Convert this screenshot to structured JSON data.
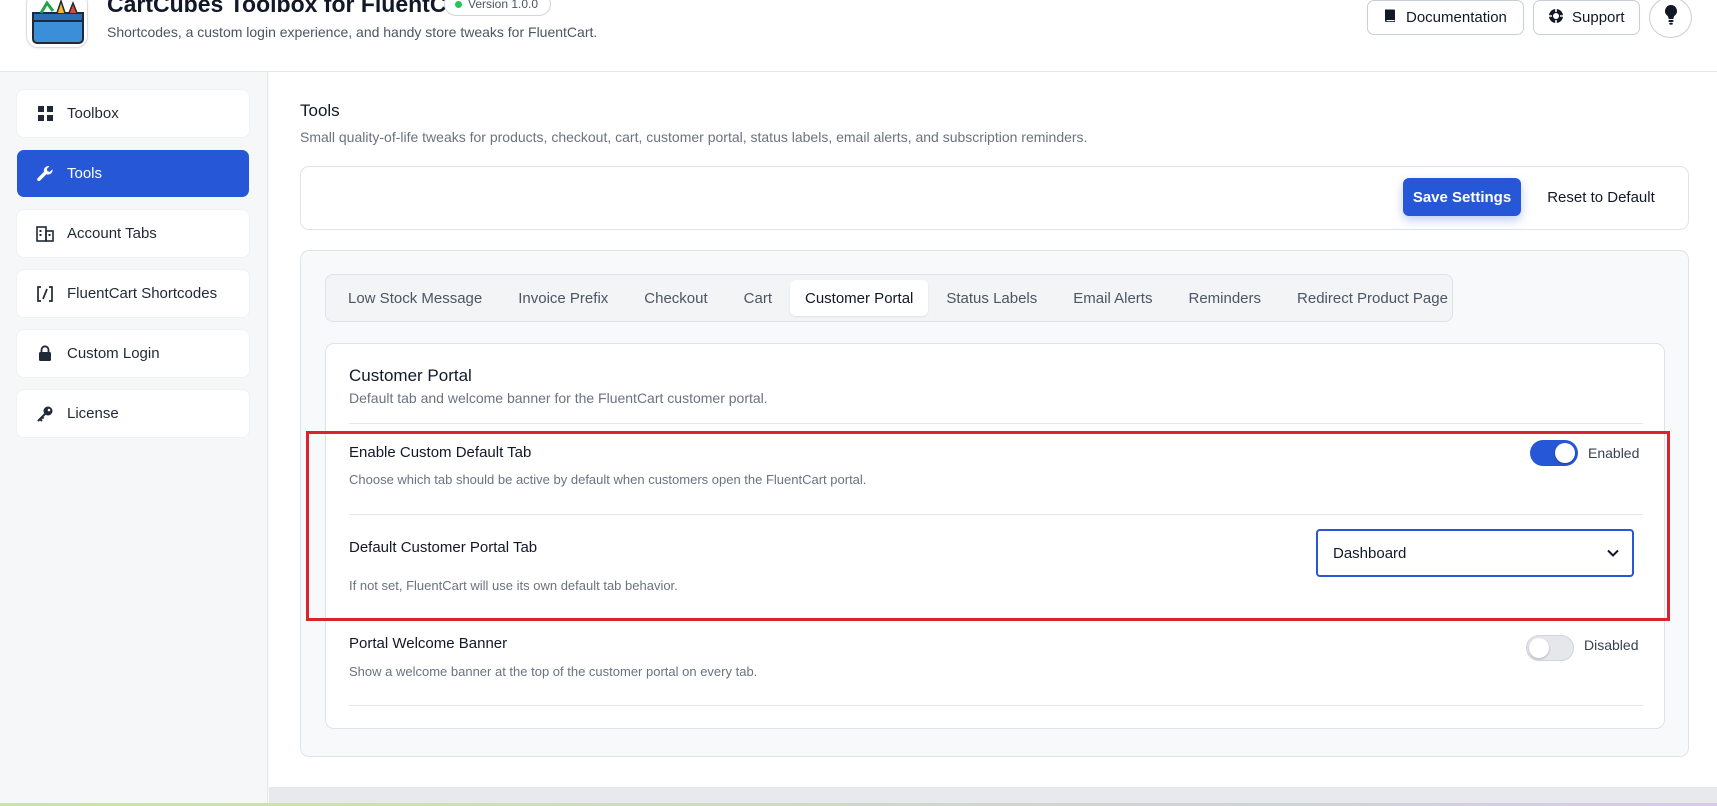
{
  "header": {
    "app_title": "CartCubes Toolbox for FluentCart",
    "version_label": "Version 1.0.0",
    "subtitle": "Shortcodes, a custom login experience, and handy store tweaks for FluentCart.",
    "documentation_label": "Documentation",
    "support_label": "Support"
  },
  "sidebar": {
    "items": [
      {
        "label": "Toolbox",
        "icon": "grid-icon"
      },
      {
        "label": "Tools",
        "icon": "wrench-icon",
        "active": true
      },
      {
        "label": "Account Tabs",
        "icon": "building-icon"
      },
      {
        "label": "FluentCart Shortcodes",
        "icon": "shortcode-icon"
      },
      {
        "label": "Custom Login",
        "icon": "lock-icon"
      },
      {
        "label": "License",
        "icon": "key-icon"
      }
    ]
  },
  "main": {
    "title": "Tools",
    "description": "Small quality-of-life tweaks for products, checkout, cart, customer portal, status labels, email alerts, and subscription reminders.",
    "save_label": "Save Settings",
    "reset_label": "Reset to Default",
    "tabs": [
      {
        "label": "Low Stock Message"
      },
      {
        "label": "Invoice Prefix"
      },
      {
        "label": "Checkout"
      },
      {
        "label": "Cart"
      },
      {
        "label": "Customer Portal",
        "active": true
      },
      {
        "label": "Status Labels"
      },
      {
        "label": "Email Alerts"
      },
      {
        "label": "Reminders"
      },
      {
        "label": "Redirect Product Page"
      }
    ],
    "panel": {
      "title": "Customer Portal",
      "description": "Default tab and welcome banner for the FluentCart customer portal.",
      "settings": [
        {
          "title": "Enable Custom Default Tab",
          "description": "Choose which tab should be active by default when customers open the FluentCart portal.",
          "toggle_state": "Enabled"
        },
        {
          "title": "Default Customer Portal Tab",
          "description": "If not set, FluentCart will use its own default tab behavior.",
          "selected_value": "Dashboard"
        },
        {
          "title": "Portal Welcome Banner",
          "description": "Show a welcome banner at the top of the customer portal on every tab.",
          "toggle_state": "Disabled"
        }
      ]
    }
  },
  "colors": {
    "accent": "#2557d6",
    "highlight": "#d9232d",
    "status_dot": "#22c55e"
  }
}
